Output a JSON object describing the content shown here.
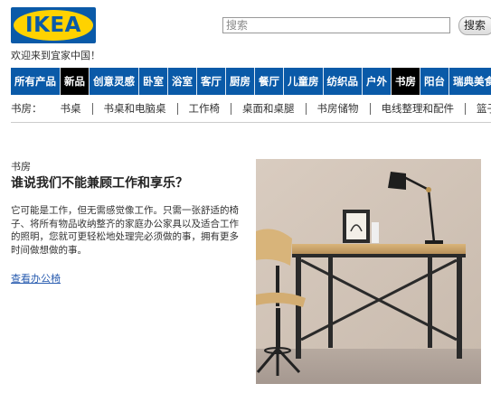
{
  "header": {
    "logo_text": "IKEA",
    "welcome_text": "欢迎来到宜家中国！",
    "search_placeholder": "搜索",
    "search_button_label": "搜索"
  },
  "nav": {
    "items": [
      {
        "label": "所有产品",
        "active": false
      },
      {
        "label": "新品",
        "active": true
      },
      {
        "label": "创意灵感",
        "active": false
      },
      {
        "label": "卧室",
        "active": false
      },
      {
        "label": "浴室",
        "active": false
      },
      {
        "label": "客厅",
        "active": false
      },
      {
        "label": "厨房",
        "active": false
      },
      {
        "label": "餐厅",
        "active": false
      },
      {
        "label": "儿童房",
        "active": false
      },
      {
        "label": "纺织品",
        "active": false
      },
      {
        "label": "户外",
        "active": false
      },
      {
        "label": "书房",
        "active": true
      },
      {
        "label": "阳台",
        "active": false
      },
      {
        "label": "瑞典美食",
        "active": false
      }
    ]
  },
  "subnav": {
    "title": "书房：",
    "links": [
      "书桌",
      "书桌和电脑桌",
      "工作椅",
      "桌面和桌腿",
      "书房储物",
      "电线整理和配件",
      "篮子"
    ]
  },
  "content": {
    "section_label": "书房",
    "headline": "谁说我们不能兼顾工作和享乐？",
    "body": "它可能是工作，但无需感觉像工作。只需一张舒适的椅子、将所有物品收纳整齐的家庭办公家具以及适合工作的照明，您就可更轻松地处理完必须做的事，拥有更多时间做想做的事。",
    "link_text": "查看办公椅"
  },
  "colors": {
    "brand_blue": "#0a5aa8",
    "brand_yellow": "#ffd200",
    "active_nav": "#000000",
    "link": "#2a5db0"
  }
}
